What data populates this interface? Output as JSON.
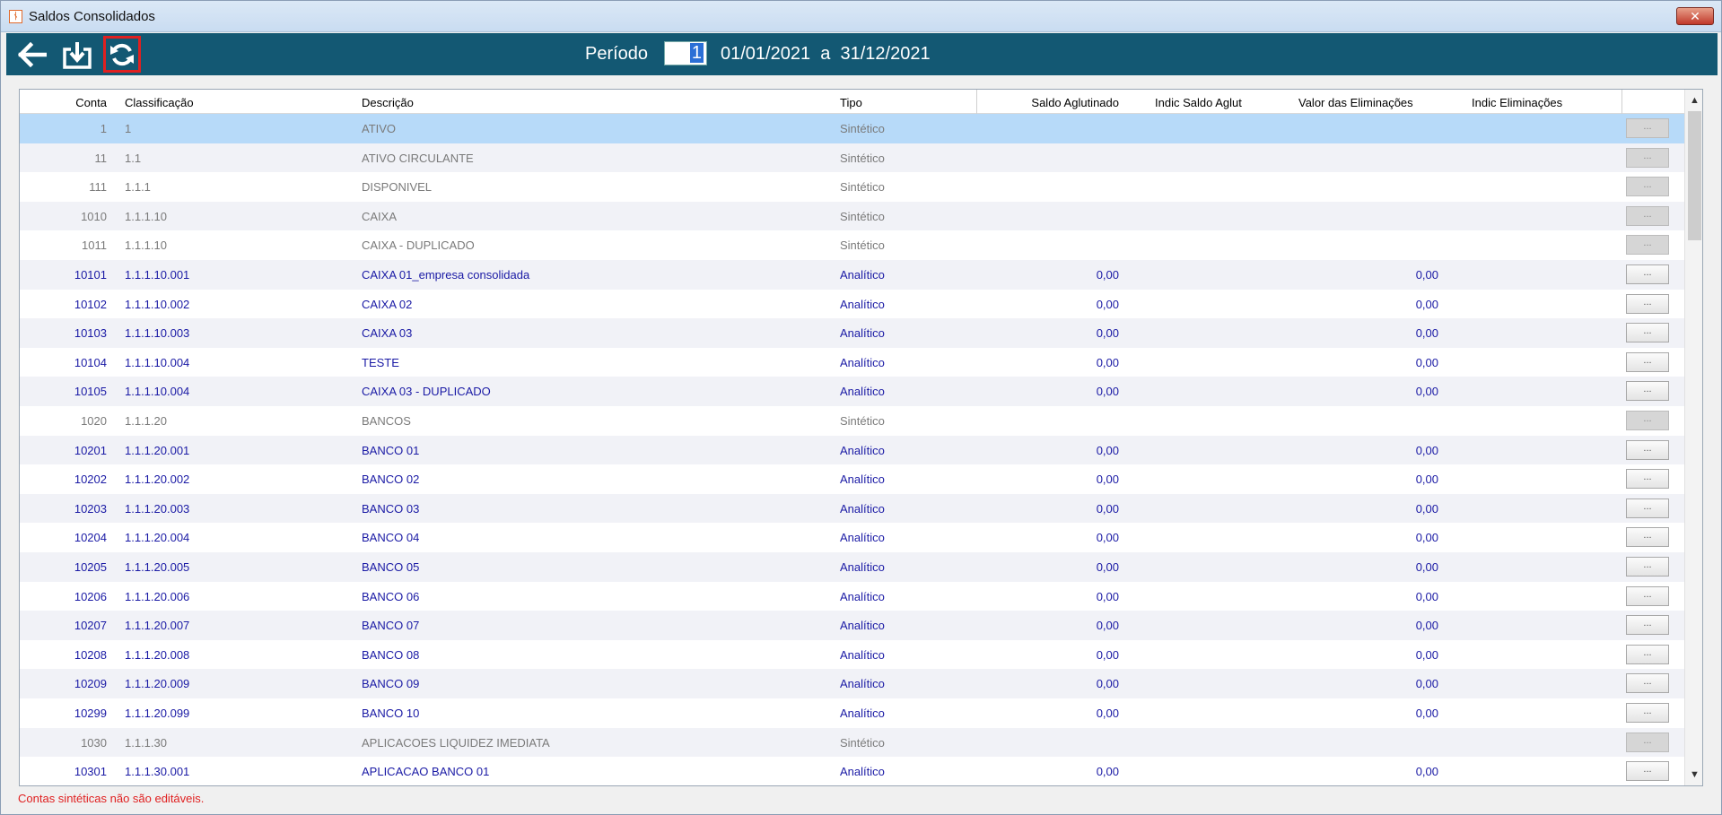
{
  "window": {
    "title": "Saldos Consolidados",
    "close_label": "✕"
  },
  "toolbar": {
    "periodo_label": "Período",
    "periodo_value": "1",
    "date_from": "01/01/2021",
    "date_sep": "a",
    "date_to": "31/12/2021"
  },
  "grid": {
    "headers": {
      "conta": "Conta",
      "classificacao": "Classificação",
      "descricao": "Descrição",
      "tipo": "Tipo",
      "saldo_aglutinado": "Saldo Aglutinado",
      "indic_saldo_aglut": "Indic Saldo Aglut",
      "valor_eliminacoes": "Valor das Eliminações",
      "indic_eliminacoes": "Indic Eliminações"
    },
    "rows": [
      {
        "conta": "1",
        "classificacao": "1",
        "descricao": "ATIVO",
        "tipo": "Sintético",
        "saldo": "",
        "elim": "",
        "kind": "sint",
        "selected": true
      },
      {
        "conta": "11",
        "classificacao": "1.1",
        "descricao": "ATIVO CIRCULANTE",
        "tipo": "Sintético",
        "saldo": "",
        "elim": "",
        "kind": "sint"
      },
      {
        "conta": "111",
        "classificacao": "1.1.1",
        "descricao": "DISPONIVEL",
        "tipo": "Sintético",
        "saldo": "",
        "elim": "",
        "kind": "sint"
      },
      {
        "conta": "1010",
        "classificacao": "1.1.1.10",
        "descricao": "CAIXA",
        "tipo": "Sintético",
        "saldo": "",
        "elim": "",
        "kind": "sint"
      },
      {
        "conta": "1011",
        "classificacao": "1.1.1.10",
        "descricao": "CAIXA - DUPLICADO",
        "tipo": "Sintético",
        "saldo": "",
        "elim": "",
        "kind": "sint"
      },
      {
        "conta": "10101",
        "classificacao": "1.1.1.10.001",
        "descricao": "CAIXA 01_empresa consolidada",
        "tipo": "Analítico",
        "saldo": "0,00",
        "elim": "0,00",
        "kind": "anal"
      },
      {
        "conta": "10102",
        "classificacao": "1.1.1.10.002",
        "descricao": "CAIXA 02",
        "tipo": "Analítico",
        "saldo": "0,00",
        "elim": "0,00",
        "kind": "anal"
      },
      {
        "conta": "10103",
        "classificacao": "1.1.1.10.003",
        "descricao": "CAIXA 03",
        "tipo": "Analítico",
        "saldo": "0,00",
        "elim": "0,00",
        "kind": "anal"
      },
      {
        "conta": "10104",
        "classificacao": "1.1.1.10.004",
        "descricao": "TESTE",
        "tipo": "Analítico",
        "saldo": "0,00",
        "elim": "0,00",
        "kind": "anal"
      },
      {
        "conta": "10105",
        "classificacao": "1.1.1.10.004",
        "descricao": "CAIXA 03 - DUPLICADO",
        "tipo": "Analítico",
        "saldo": "0,00",
        "elim": "0,00",
        "kind": "anal"
      },
      {
        "conta": "1020",
        "classificacao": "1.1.1.20",
        "descricao": "BANCOS",
        "tipo": "Sintético",
        "saldo": "",
        "elim": "",
        "kind": "sint"
      },
      {
        "conta": "10201",
        "classificacao": "1.1.1.20.001",
        "descricao": "BANCO 01",
        "tipo": "Analítico",
        "saldo": "0,00",
        "elim": "0,00",
        "kind": "anal"
      },
      {
        "conta": "10202",
        "classificacao": "1.1.1.20.002",
        "descricao": "BANCO 02",
        "tipo": "Analítico",
        "saldo": "0,00",
        "elim": "0,00",
        "kind": "anal"
      },
      {
        "conta": "10203",
        "classificacao": "1.1.1.20.003",
        "descricao": "BANCO 03",
        "tipo": "Analítico",
        "saldo": "0,00",
        "elim": "0,00",
        "kind": "anal"
      },
      {
        "conta": "10204",
        "classificacao": "1.1.1.20.004",
        "descricao": "BANCO 04",
        "tipo": "Analítico",
        "saldo": "0,00",
        "elim": "0,00",
        "kind": "anal"
      },
      {
        "conta": "10205",
        "classificacao": "1.1.1.20.005",
        "descricao": "BANCO 05",
        "tipo": "Analítico",
        "saldo": "0,00",
        "elim": "0,00",
        "kind": "anal"
      },
      {
        "conta": "10206",
        "classificacao": "1.1.1.20.006",
        "descricao": "BANCO 06",
        "tipo": "Analítico",
        "saldo": "0,00",
        "elim": "0,00",
        "kind": "anal"
      },
      {
        "conta": "10207",
        "classificacao": "1.1.1.20.007",
        "descricao": "BANCO 07",
        "tipo": "Analítico",
        "saldo": "0,00",
        "elim": "0,00",
        "kind": "anal"
      },
      {
        "conta": "10208",
        "classificacao": "1.1.1.20.008",
        "descricao": "BANCO 08",
        "tipo": "Analítico",
        "saldo": "0,00",
        "elim": "0,00",
        "kind": "anal"
      },
      {
        "conta": "10209",
        "classificacao": "1.1.1.20.009",
        "descricao": "BANCO 09",
        "tipo": "Analítico",
        "saldo": "0,00",
        "elim": "0,00",
        "kind": "anal"
      },
      {
        "conta": "10299",
        "classificacao": "1.1.1.20.099",
        "descricao": "BANCO 10",
        "tipo": "Analítico",
        "saldo": "0,00",
        "elim": "0,00",
        "kind": "anal"
      },
      {
        "conta": "1030",
        "classificacao": "1.1.1.30",
        "descricao": "APLICACOES LIQUIDEZ IMEDIATA",
        "tipo": "Sintético",
        "saldo": "",
        "elim": "",
        "kind": "sint"
      },
      {
        "conta": "10301",
        "classificacao": "1.1.1.30.001",
        "descricao": "APLICACAO BANCO 01",
        "tipo": "Analítico",
        "saldo": "0,00",
        "elim": "0,00",
        "kind": "anal"
      }
    ],
    "button_label": "..."
  },
  "status": {
    "message": "Contas sintéticas não são editáveis."
  },
  "icons": {
    "back": "back-arrow-icon",
    "download": "download-icon",
    "refresh": "refresh-icon",
    "scroll_up": "▲",
    "scroll_down": "▼"
  },
  "colors": {
    "toolbar": "#135873",
    "selected_row": "#b7daf9",
    "analitico_text": "#1a1aa5",
    "sintetico_text": "#7a7a7a",
    "status_text": "#e02020"
  }
}
